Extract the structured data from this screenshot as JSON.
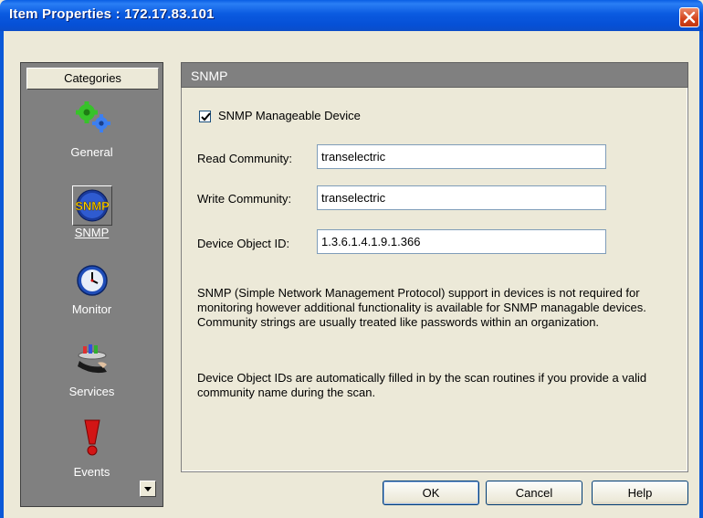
{
  "window": {
    "title": "Item Properties : 172.17.83.101"
  },
  "sidebar": {
    "header": "Categories",
    "items": [
      {
        "label": "General",
        "icon": "gears-icon"
      },
      {
        "label": "SNMP",
        "icon": "snmp-icon",
        "selected": true
      },
      {
        "label": "Monitor",
        "icon": "clock-icon"
      },
      {
        "label": "Services",
        "icon": "services-icon"
      },
      {
        "label": "Events",
        "icon": "exclamation-icon"
      }
    ]
  },
  "panel": {
    "title": "SNMP",
    "snmp_manageable": {
      "label": "SNMP Manageable Device",
      "checked": true
    },
    "read_community": {
      "label": "Read Community:",
      "value": "transelectric"
    },
    "write_community": {
      "label": "Write Community:",
      "value": "transelectric"
    },
    "device_object_id": {
      "label": "Device Object ID:",
      "value": "1.3.6.1.4.1.9.1.366"
    },
    "description1": "SNMP (Simple Network Management Protocol) support in devices is not required for monitoring however additional functionality is available for SNMP managable devices.  Community strings are usually treated like passwords within an organization.",
    "description2": "Device Object IDs are automatically filled in by the scan routines if you provide a valid community name during the scan."
  },
  "buttons": {
    "ok": "OK",
    "cancel": "Cancel",
    "help": "Help"
  },
  "colors": {
    "titlebar": "#0a5ae0",
    "sidebar": "#808080",
    "panel_header": "#808080",
    "dialog_bg": "#ece9d8"
  }
}
